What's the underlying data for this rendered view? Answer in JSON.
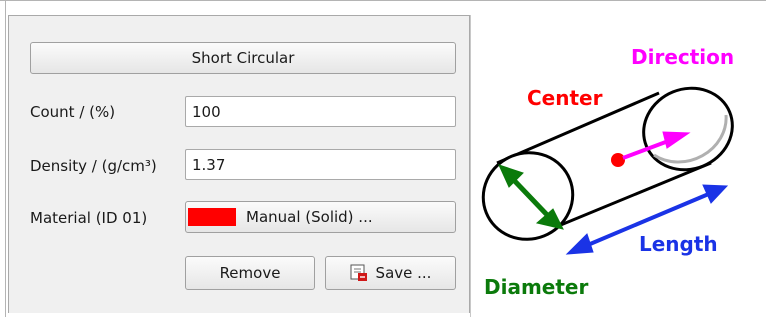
{
  "form": {
    "type_button_label": "Short Circular",
    "count": {
      "label": "Count / (%)",
      "value": "100"
    },
    "density": {
      "label": "Density / (g/cm³)",
      "value": "1.37"
    },
    "material": {
      "label": "Material (ID 01)",
      "button_label": "Manual (Solid) ...",
      "swatch_color": "#ff0000"
    },
    "remove_label": "Remove",
    "save_label": "Save ..."
  },
  "diagram": {
    "labels": {
      "center": "Center",
      "direction": "Direction",
      "length": "Length",
      "diameter": "Diameter"
    },
    "colors": {
      "center": "#ff0000",
      "direction": "#ff00ff",
      "length": "#1a33e6",
      "diameter": "#0b7a0b"
    }
  }
}
